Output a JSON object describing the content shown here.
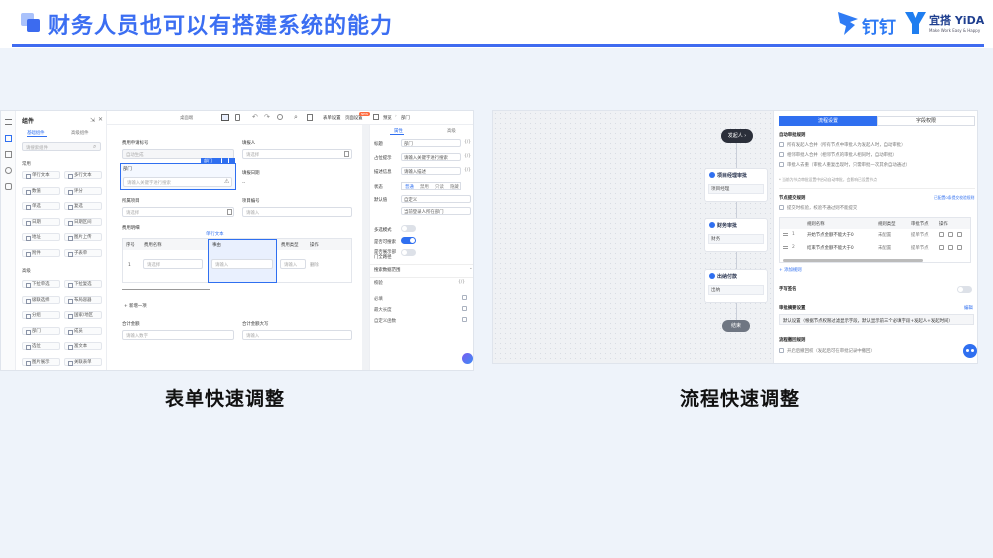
{
  "header": {
    "title": "财务人员也可以有搭建系统的能力",
    "logo_dingtalk": "钉钉",
    "logo_yida": "宜搭 YiDA",
    "logo_yida_slogan": "Make Work Easy & Happy"
  },
  "captions": {
    "left": "表单快速调整",
    "right": "流程快速调整"
  },
  "form_editor": {
    "components_panel": {
      "title": "组件",
      "tab_active": "基础组件",
      "tab_other": "高级组件",
      "search_placeholder": "请搜索组件",
      "section1": "常用",
      "section2": "高级",
      "items1": [
        "单行文本",
        "多行文本",
        "数值",
        "评分",
        "单选",
        "复选",
        "日期",
        "日期区间",
        "地址",
        "图片上传",
        "附件",
        "子表单"
      ],
      "items2": [
        "下拉单选",
        "下拉复选",
        "级联选择",
        "布局容器",
        "分组",
        "国家/地区",
        "部门",
        "成员",
        "选位",
        "富文本",
        "图片展示",
        "关联表单"
      ]
    },
    "toolbar": {
      "device": "桌面端",
      "undo": "撤销",
      "redo": "重做",
      "form_settings": "表单设置",
      "page_settings": "页面设置",
      "badge": "NEW",
      "save": "保存",
      "preview": "预览",
      "tree": "部门"
    },
    "canvas": {
      "field_title": "费用申请标号",
      "field_title_value": "自动生成",
      "applicant": "填报人",
      "applicant_ph": "请选择",
      "dept": "部门",
      "dept_ph": "请输入关键字进行搜索",
      "dept_tag": "部门",
      "fill_date": "填报日期",
      "fill_date_value": "--",
      "project": "所属项目",
      "project_ph": "请选择",
      "project_no": "项目编号",
      "project_no_ph": "请输入",
      "detail": "费用明细",
      "detail_link": "单行文本",
      "table_headers": [
        "序号",
        "费用名称",
        "事由",
        "费用类型",
        "操作"
      ],
      "table_row": {
        "index": "1",
        "name_ph": "请选择",
        "reason_ph": "请输入",
        "type_ph": "请输入",
        "op": "删除"
      },
      "add_row": "+ 新增一项",
      "total": "合计金额",
      "total_ph": "请输入数字",
      "total_cn": "合计金额大写",
      "total_cn_ph": "请输入"
    },
    "props": {
      "tab1": "属性",
      "tab2": "高级",
      "label": "标题",
      "label_value": "部门",
      "placeholder": "占位提示",
      "placeholder_value": "请输入关键字进行搜索",
      "desc": "描述信息",
      "desc_value": "请输入描述",
      "status": "状态",
      "status_opts": [
        "普通",
        "禁用",
        "只读",
        "隐藏"
      ],
      "default": "默认值",
      "default_value": "自定义",
      "default2_value": "当前登录人所在部门",
      "multi": "多选模式",
      "search": "是否可搜索",
      "show_all": "是否展示部门全路径",
      "search_scope": "搜索数据范围",
      "validation": "校验",
      "required": "必填",
      "max": "最大长度",
      "custom": "自定义函数"
    }
  },
  "flow_editor": {
    "start": "发起人",
    "nodes": [
      {
        "title": "项目经理审批",
        "value": "项目经理"
      },
      {
        "title": "财务审批",
        "value": "财务"
      },
      {
        "title": "出纳付款",
        "value": "出纳"
      }
    ],
    "end": "结束",
    "tabs": [
      "流程设置",
      "字段权限"
    ],
    "auto_section": "自动审批规则",
    "auto_opts": [
      "所有发起人合并（所有节点中审批人为发起人时，自动审批）",
      "相邻审批人合并（相邻节点的审批人相同时，自动审批）",
      "审批人去重（审批人重复出现时，只需审批一次其余自动通过）"
    ],
    "auto_note": "* 当前为节点审批设置中启动自动审批，会影响已设置节点",
    "submit_section": "节点提交规则",
    "submit_link": "已配置0条提交校验规则",
    "submit_sub": "提交时校验，校验不通过则不能提交",
    "rule_headers": [
      "规则名称",
      "规则类型",
      "审批节点",
      "操作"
    ],
    "rules": [
      {
        "no": "1",
        "name": "开始节点金额不能大于0",
        "type": "未配置",
        "node": "提单节点"
      },
      {
        "no": "2",
        "name": "结束节点金额不能大于0",
        "type": "未配置",
        "node": "提单节点"
      }
    ],
    "add_rule": "+ 添加规则",
    "sign": "手写签名",
    "summary_section": "审批摘要设置",
    "summary_link": "编辑",
    "summary_value": "默认设置（根据节点权限过滤显示字段，默认显示前三个必填字段+发起人+发起时间）",
    "recall_section": "流程撤回规则",
    "recall_opt": "开启后撤回权（发起后可在审批记录中撤回）"
  }
}
